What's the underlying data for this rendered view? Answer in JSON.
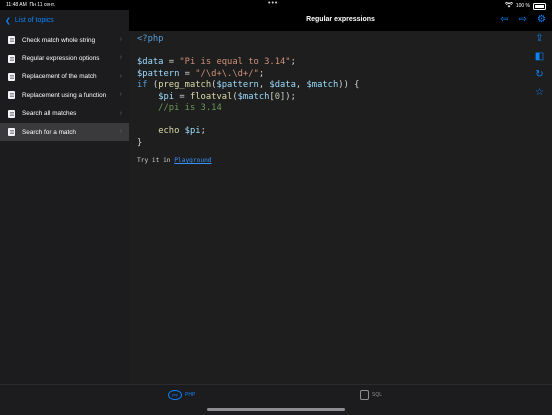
{
  "status": {
    "time": "11:48 AM",
    "date": "Пн 11 сент.",
    "battery": "100 %"
  },
  "sidebar": {
    "back_label": "List of topics",
    "items": [
      {
        "label": "Check match whole string"
      },
      {
        "label": "Regular expression options"
      },
      {
        "label": "Replacement of the match"
      },
      {
        "label": "Replacement using a function"
      },
      {
        "label": "Search all matches"
      },
      {
        "label": "Search for a match",
        "selected": true
      }
    ]
  },
  "header": {
    "title": "Regular expressions"
  },
  "code": {
    "lines": [
      "<?php",
      "",
      "$data = \"Pi is equal to 3.14\";",
      "$pattern = \"/\\d+\\.\\d+/\";",
      "if (preg_match($pattern, $data, $match)) {",
      "    $pi = floatval($match[0]);",
      "    //pi is 3.14",
      "",
      "    echo $pi;",
      "}"
    ]
  },
  "tryit": {
    "prefix": "Try it in ",
    "link": "Playground"
  },
  "tabs": [
    {
      "label": "PHP",
      "active": true
    },
    {
      "label": "SQL",
      "active": false
    }
  ],
  "colors": {
    "accent": "#0a84ff",
    "background": "#1e1e1e",
    "sidebar": "#1c1c1e"
  }
}
